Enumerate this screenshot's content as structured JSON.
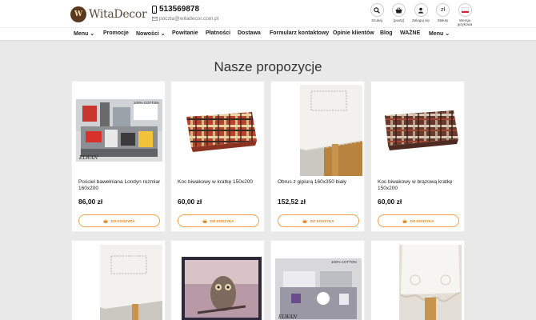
{
  "brand": {
    "name": "WitaDecor"
  },
  "contact": {
    "phone": "513569878",
    "email": "poczta@witadecor.com.pl"
  },
  "tools": [
    {
      "label": "Szukaj",
      "icon": "search-icon"
    },
    {
      "label": "(pusty)",
      "icon": "basket-icon"
    },
    {
      "label": "Zaloguj się",
      "icon": "user-icon"
    },
    {
      "label": "Waluty",
      "icon": "currency-icon",
      "symbol": "zł"
    },
    {
      "label": "Wersja językowa",
      "icon": "flag-pl-icon"
    }
  ],
  "nav": [
    "Menu",
    "Promocje",
    "Nowości",
    "Powitanie",
    "Płatności",
    "Dostawa",
    "Formularz kontaktowy",
    "Opinie klientów",
    "Blog",
    "WAŻNE",
    "Menu"
  ],
  "section_title": "Nasze propozycje",
  "add_to_cart_label": "DO KOSZYKA",
  "products": [
    {
      "title": "Pościel bawełniana Londyn rozmiar 160x200",
      "price": "86,00 zł",
      "badge": "100% COTTON",
      "brand_mark": "ELWAN"
    },
    {
      "title": "Koc biwakowy w kratkę 150x200",
      "price": "60,00 zł"
    },
    {
      "title": "Obrus z gipiurą 160x350 biały",
      "price": "152,52 zł"
    },
    {
      "title": "Koc biwakowy w brązową kratkę 150x200",
      "price": "60,00 zł"
    }
  ],
  "products_row2": [
    {
      "image": "tablecloth"
    },
    {
      "image": "owl-blanket"
    },
    {
      "image": "bedding-grey",
      "badge": "100% COTTON",
      "brand_mark": "ELWAN"
    },
    {
      "image": "lace-tablecloth"
    }
  ],
  "colors": {
    "accent": "#f0a04b",
    "accent_text": "#e0861f",
    "background": "#e9e9e9"
  }
}
